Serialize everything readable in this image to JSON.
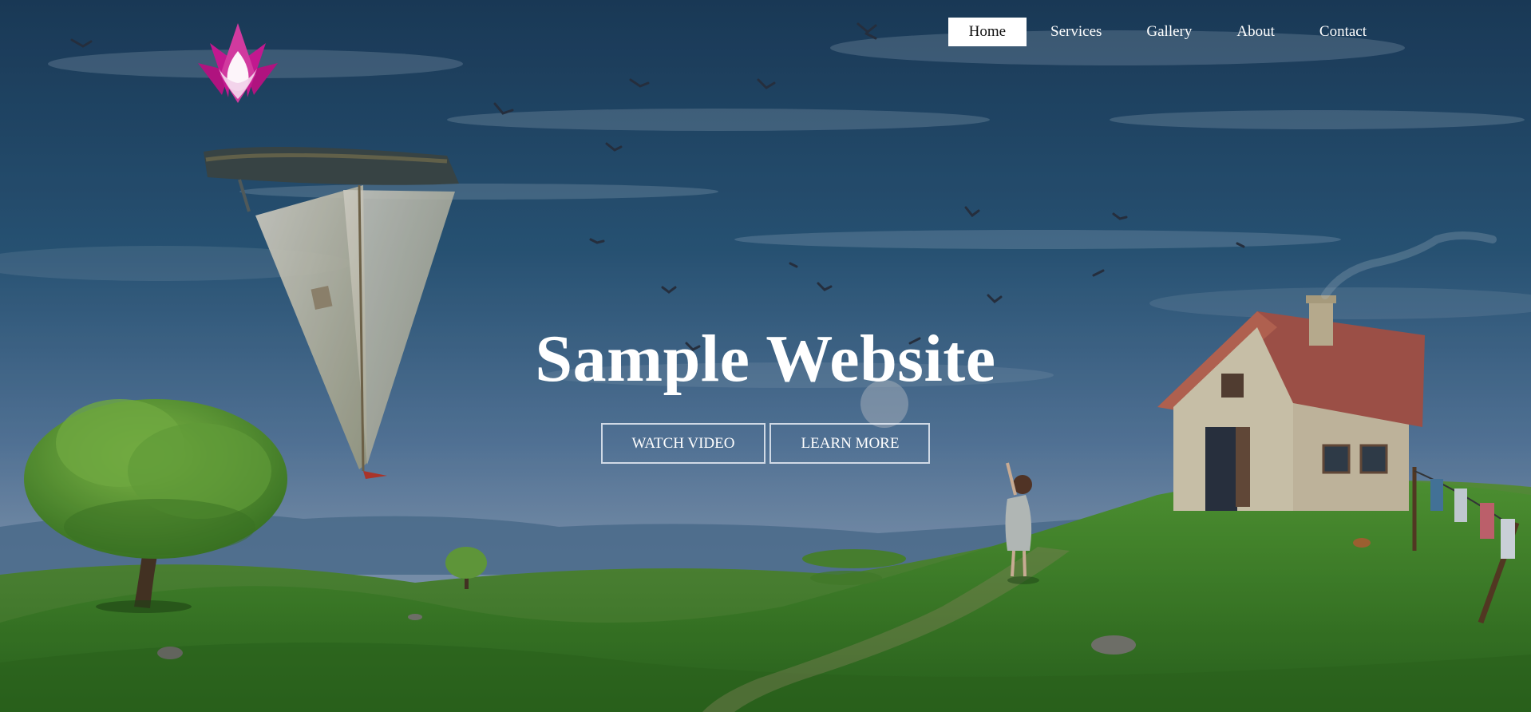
{
  "nav": {
    "items": [
      {
        "label": "Home",
        "active": true
      },
      {
        "label": "Services",
        "active": false
      },
      {
        "label": "Gallery",
        "active": false
      },
      {
        "label": "About",
        "active": false
      },
      {
        "label": "Contact",
        "active": false
      }
    ]
  },
  "hero": {
    "title": "Sample Website",
    "watch_video_label": "WATCH VIDEO",
    "learn_more_label": "LEARN MORE"
  },
  "logo": {
    "icon": "lotus-icon",
    "colors": {
      "outer": "#c2188f",
      "inner": "#ffffff"
    }
  },
  "background": {
    "scene": "illustrated-landscape",
    "colors": {
      "sky_top": "#1f4565",
      "sky_bottom": "#7d99b8",
      "hills": "#3f8b2a",
      "grass_light": "#62a93a",
      "house_wall": "#d8ccb0",
      "roof": "#b85a45"
    }
  }
}
